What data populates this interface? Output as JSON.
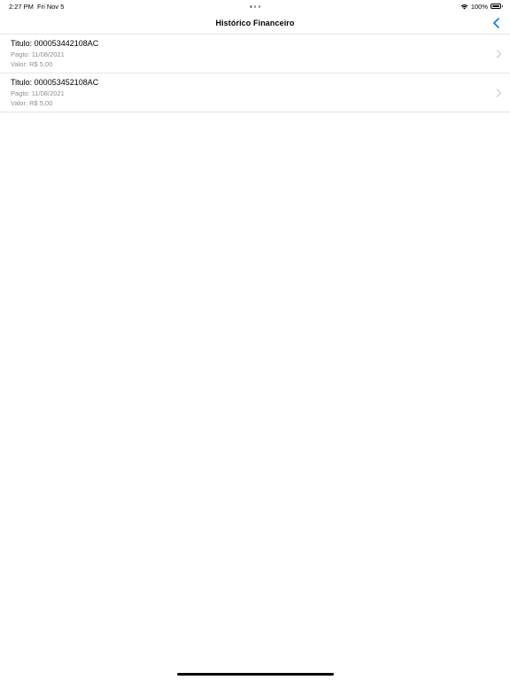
{
  "status_bar": {
    "time": "2:27 PM",
    "date": "Fri Nov 5",
    "battery": "100%",
    "icons": [
      "wifi-icon",
      "battery-icon"
    ]
  },
  "nav": {
    "title": "Histórico Financeiro",
    "back_icon": "chevron-left-icon",
    "accent": "#007aff"
  },
  "items": [
    {
      "titulo": "Titulo: 000053442108AC",
      "pagto": "Pagto: 11/08/2021",
      "valor": "Valor: R$ 5,00"
    },
    {
      "titulo": "Titulo: 000053452108AC",
      "pagto": "Pagto: 11/08/2021",
      "valor": "Valor: R$ 5,00"
    }
  ],
  "colors": {
    "secondary_text": "#8e8e93",
    "separator": "#e5e5ea",
    "chevron": "#c7c7cc"
  }
}
